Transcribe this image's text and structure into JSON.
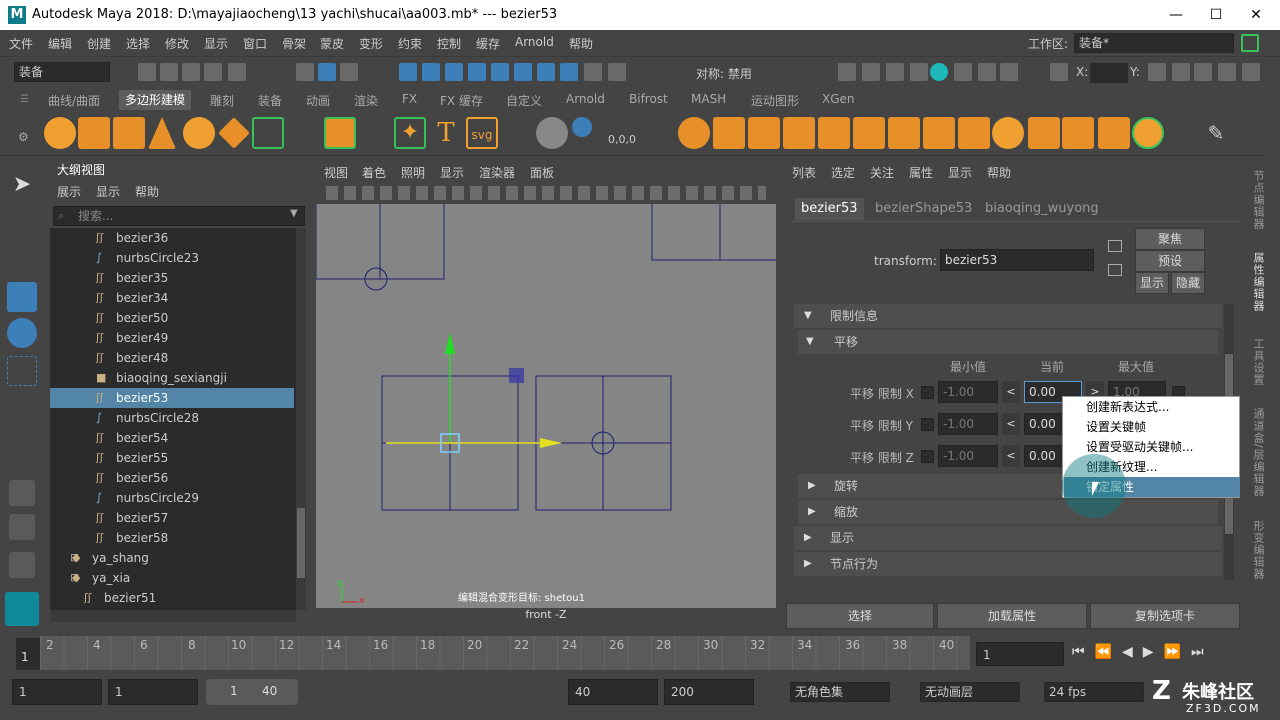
{
  "title_bar": {
    "logo": "M",
    "text": "Autodesk Maya 2018: D:\\mayajiaocheng\\13 yachi\\shucai\\aa003.mb*    ---    bezier53",
    "minimize": "—",
    "maximize": "☐",
    "close": "✕"
  },
  "menu": {
    "items": [
      "文件",
      "编辑",
      "创建",
      "选择",
      "修改",
      "显示",
      "窗口",
      "骨架",
      "蒙皮",
      "变形",
      "约束",
      "控制",
      "缓存",
      "Arnold",
      "帮助"
    ],
    "workspace_label": "工作区:",
    "workspace_value": "装备*"
  },
  "toolbar": {
    "mode_value": "装备",
    "symmetry_label": "对称: 禁用",
    "x_label": "X:",
    "y_label": "Y:"
  },
  "shelf": {
    "tabs": [
      "曲线/曲面",
      "多边形建模",
      "雕刻",
      "装备",
      "动画",
      "渲染",
      "FX",
      "FX 缓存",
      "自定义",
      "Arnold",
      "Bifrost",
      "MASH",
      "运动图形",
      "XGen"
    ],
    "active_tab": "多边形建模",
    "text_icon": "T",
    "svg_icon": "svg",
    "coord_icon": "0,0,0"
  },
  "outliner": {
    "title": "大纲视图",
    "menu": [
      "展示",
      "显示",
      "帮助"
    ],
    "search_placeholder": "搜索...",
    "items": [
      {
        "name": "bezier36",
        "icon": "curve"
      },
      {
        "name": "nurbsCircle23",
        "icon": "circle"
      },
      {
        "name": "bezier35",
        "icon": "curve"
      },
      {
        "name": "bezier34",
        "icon": "curve"
      },
      {
        "name": "bezier50",
        "icon": "curve"
      },
      {
        "name": "bezier49",
        "icon": "curve"
      },
      {
        "name": "bezier48",
        "icon": "curve"
      },
      {
        "name": "biaoqing_sexiangji",
        "icon": "camera"
      },
      {
        "name": "bezier53",
        "icon": "curve",
        "selected": true
      },
      {
        "name": "nurbsCircle28",
        "icon": "circle"
      },
      {
        "name": "bezier54",
        "icon": "curve"
      },
      {
        "name": "bezier55",
        "icon": "curve"
      },
      {
        "name": "bezier56",
        "icon": "curve"
      },
      {
        "name": "nurbsCircle29",
        "icon": "circle"
      },
      {
        "name": "bezier57",
        "icon": "curve"
      },
      {
        "name": "bezier58",
        "icon": "curve"
      },
      {
        "name": "ya_shang",
        "icon": "group"
      },
      {
        "name": "ya_xia",
        "icon": "group"
      },
      {
        "name": "bezier51",
        "icon": "curve"
      }
    ]
  },
  "viewport": {
    "menu": [
      "视图",
      "着色",
      "照明",
      "显示",
      "渲染器",
      "面板"
    ],
    "hud_text": "编辑混合变形目标: shetou1",
    "camera_label": "front -Z",
    "axis_y": "y",
    "axis_x": "x"
  },
  "attribute_editor": {
    "menu": [
      "列表",
      "选定",
      "关注",
      "属性",
      "显示",
      "帮助"
    ],
    "tabs": [
      "bezier53",
      "bezierShape53",
      "biaoqing_wuyong"
    ],
    "active_tab": "bezier53",
    "transform_label": "transform:",
    "transform_value": "bezier53",
    "focus_button": "聚焦",
    "preset_button": "预设",
    "show_button": "显示",
    "hide_button": "隐藏",
    "limit_section": "限制信息",
    "translate_section": "平移",
    "col_min": "最小值",
    "col_current": "当前",
    "col_max": "最大值",
    "rows": [
      {
        "label": "平移 限制 X",
        "min": "-1.00",
        "current": "0.00",
        "max": "1.00"
      },
      {
        "label": "平移 限制 Y",
        "min": "-1.00",
        "current": "0.00"
      },
      {
        "label": "平移 限制 Z",
        "min": "-1.00",
        "current": "0.00"
      }
    ],
    "lt_symbol": "<",
    "gt_symbol": ">",
    "rotate_section": "旋转",
    "scale_section": "缩放",
    "display_section": "显示",
    "node_behavior_section": "节点行为",
    "select_button": "选择",
    "load_attrs_button": "加载属性",
    "copy_tab_button": "复制选项卡"
  },
  "context_menu": {
    "items": [
      "创建新表达式...",
      "设置关键帧",
      "设置受驱动关键帧...",
      "创建新纹理...",
      "锁定属性"
    ],
    "highlighted": "锁定属性"
  },
  "right_tabs": [
    "节点编辑器",
    "属性编辑器",
    "工具设置",
    "通道盒/层编辑器",
    "形变编辑器"
  ],
  "active_right_tab": "属性编辑器",
  "timeline": {
    "ticks": [
      "1",
      "2",
      "4",
      "6",
      "8",
      "10",
      "12",
      "14",
      "16",
      "18",
      "20",
      "22",
      "24",
      "26",
      "28",
      "30",
      "32",
      "34",
      "36",
      "38",
      "40"
    ],
    "current_frame": "1"
  },
  "range": {
    "start": "1",
    "playback_start": "1",
    "slider_start": "1",
    "slider_end": "40",
    "playback_end": "40",
    "end": "200",
    "char_set": "无角色集",
    "anim_layer": "无动画层",
    "fps": "24 fps"
  },
  "watermark": {
    "name": "朱峰社区",
    "url": "ZF3D.COM"
  }
}
